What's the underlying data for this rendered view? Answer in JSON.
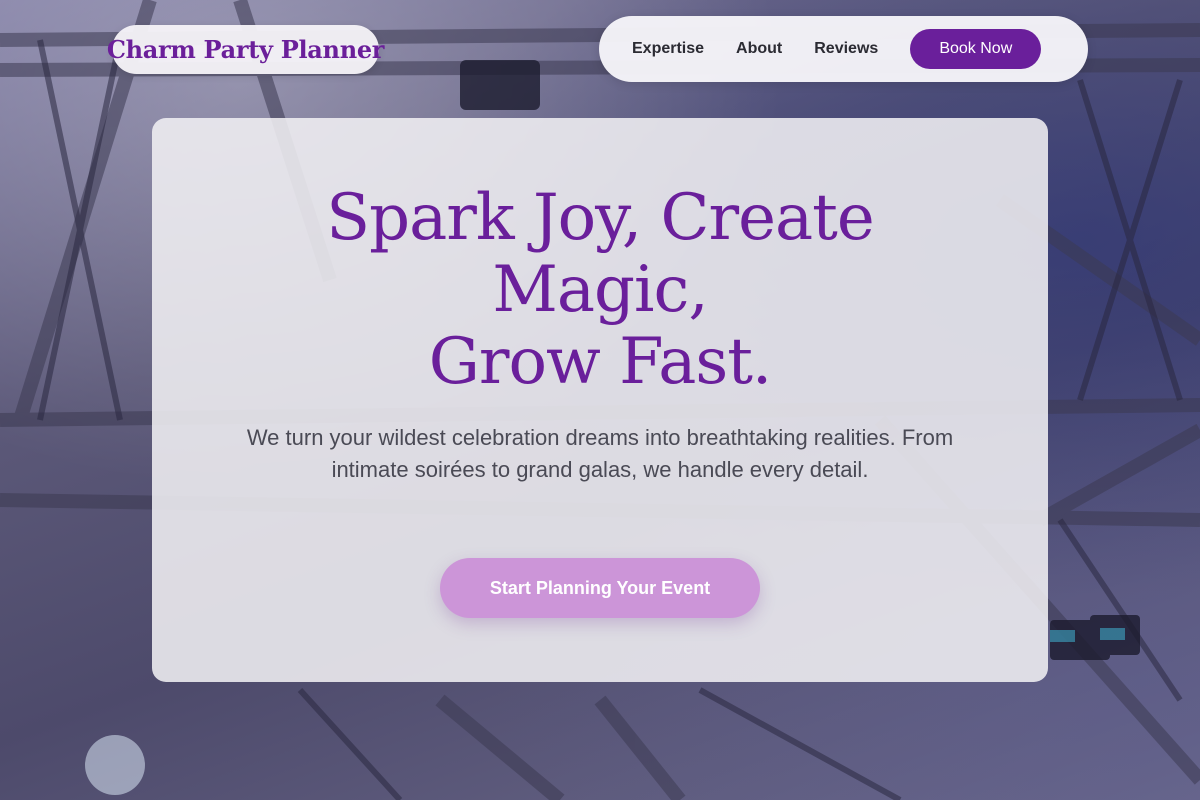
{
  "brand": {
    "name": "Charm Party Planner",
    "color": "#6a1f9b"
  },
  "nav": {
    "items": [
      {
        "label": "Expertise"
      },
      {
        "label": "About"
      },
      {
        "label": "Reviews"
      }
    ],
    "cta_label": "Book Now"
  },
  "hero": {
    "headline_line1": "Spark Joy, Create",
    "headline_line2": "Magic,",
    "headline_line3": "Grow Fast.",
    "subtitle": "We turn your wildest celebration dreams into breathtaking realities. From intimate soirées to grand galas, we handle every detail.",
    "cta_label": "Start Planning Your Event",
    "cta_color": "#cc95d8"
  }
}
